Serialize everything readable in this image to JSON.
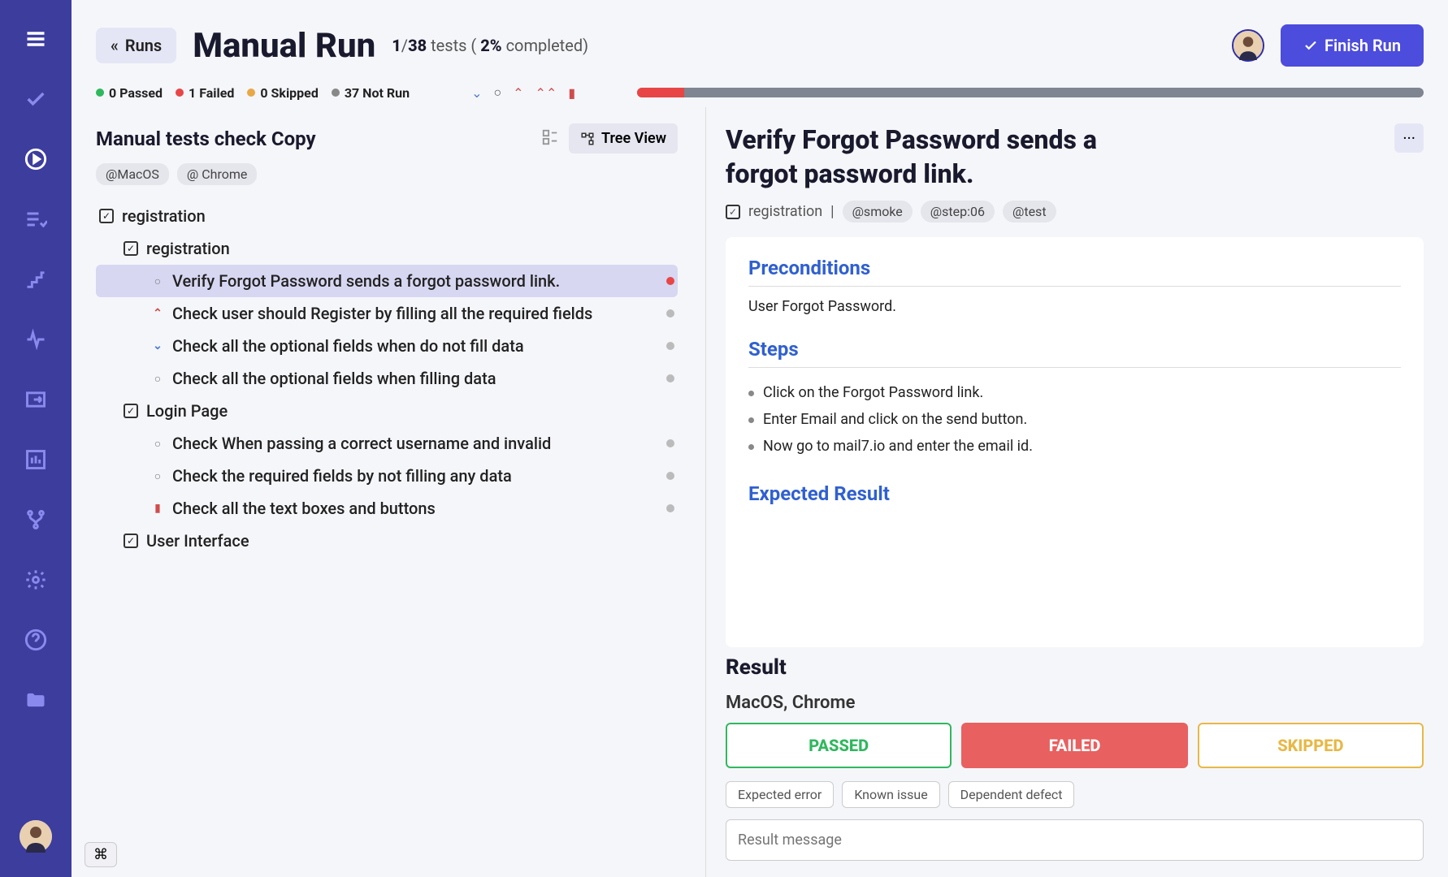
{
  "header": {
    "back_label": "Runs",
    "title": "Manual Run",
    "tests_done": "1",
    "tests_total": "38",
    "tests_word": "tests",
    "percent": "2%",
    "completed_word": "completed",
    "finish_label": "Finish Run"
  },
  "stats": {
    "passed": "0 Passed",
    "failed": "1 Failed",
    "skipped": "0 Skipped",
    "notrun": "37 Not Run"
  },
  "left": {
    "title": "Manual tests check Copy",
    "tree_view_label": "Tree View",
    "tags": [
      "@MacOS",
      "@ Chrome"
    ],
    "tree": [
      {
        "level": 0,
        "type": "folder",
        "text": "registration"
      },
      {
        "level": 1,
        "type": "folder",
        "text": "registration"
      },
      {
        "level": 2,
        "type": "test",
        "text": "Verify Forgot Password sends a forgot password link.",
        "status": "circle",
        "ind": "red",
        "selected": true
      },
      {
        "level": 2,
        "type": "test",
        "text": "Check user should Register by filling all the required fields",
        "status": "up-red",
        "ind": "gray"
      },
      {
        "level": 2,
        "type": "test",
        "text": "Check all the optional fields when do not fill data",
        "status": "down-blue",
        "ind": "gray"
      },
      {
        "level": 2,
        "type": "test",
        "text": "Check all the optional fields when filling data",
        "status": "circle",
        "ind": "gray"
      },
      {
        "level": 1,
        "type": "folder",
        "text": "Login Page"
      },
      {
        "level": 2,
        "type": "test",
        "text": "Check When passing a correct username and invalid",
        "status": "circle",
        "ind": "gray"
      },
      {
        "level": 2,
        "type": "test",
        "text": "Check the required fields by not filling any data",
        "status": "circle",
        "ind": "gray"
      },
      {
        "level": 2,
        "type": "test",
        "text": "Check all the text boxes and buttons",
        "status": "flag-red",
        "ind": "gray"
      },
      {
        "level": 1,
        "type": "folder",
        "text": "User Interface"
      }
    ]
  },
  "detail": {
    "title": "Verify Forgot Password sends a forgot password link.",
    "breadcrumb": "registration",
    "tags": [
      "@smoke",
      "@step:06",
      "@test"
    ],
    "preconditions_label": "Preconditions",
    "preconditions_text": "User Forgot Password.",
    "steps_label": "Steps",
    "steps": [
      "Click on the Forgot Password link.",
      "Enter Email and click on the send button.",
      "Now go to mail7.io and enter the email id."
    ],
    "expected_label": "Expected Result",
    "result_label": "Result",
    "env": "MacOS, Chrome",
    "btn_passed": "PASSED",
    "btn_failed": "FAILED",
    "btn_skipped": "SKIPPED",
    "defects": [
      "Expected error",
      "Known issue",
      "Dependent defect"
    ],
    "msg_placeholder": "Result message"
  },
  "kbd_hint": "⌘"
}
